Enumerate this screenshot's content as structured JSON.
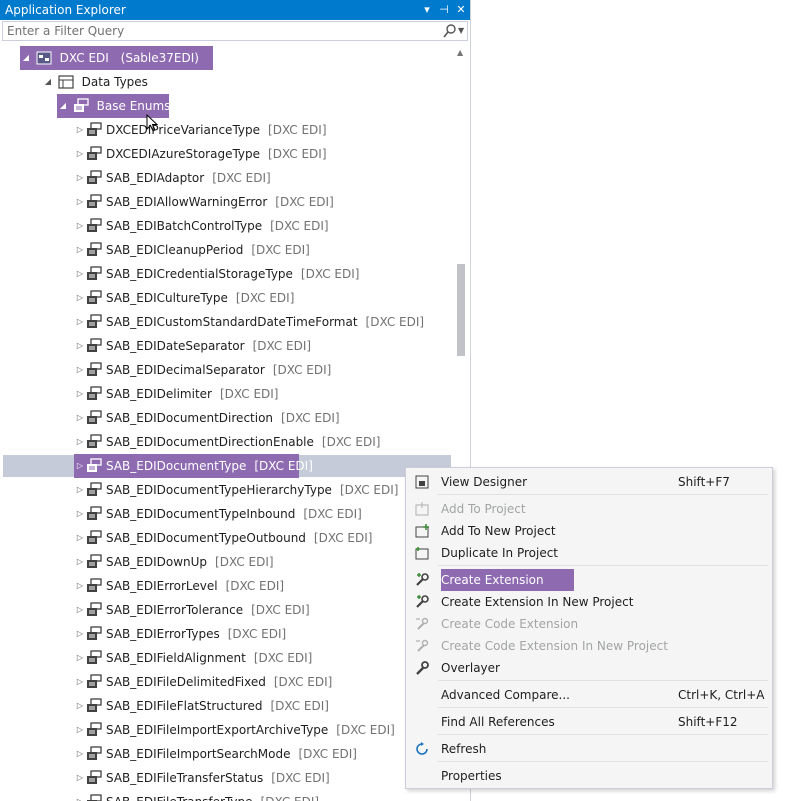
{
  "window": {
    "title": "Application Explorer",
    "buttons": [
      {
        "name": "dropdown",
        "glyph": "▾"
      },
      {
        "name": "pin",
        "glyph": "⊣"
      },
      {
        "name": "close",
        "glyph": "✕"
      }
    ]
  },
  "filter": {
    "placeholder": "Enter a Filter Query",
    "value": ""
  },
  "tree": {
    "root": {
      "label": "DXC EDI",
      "tag": "(Sable37EDI)",
      "expanded": true
    },
    "data_types": {
      "label": "Data Types",
      "expanded": true
    },
    "base_enums": {
      "label": "Base Enums",
      "expanded": true
    },
    "items": [
      {
        "label": "DXCEDIPriceVarianceType",
        "tag": "[DXC EDI]"
      },
      {
        "label": "DXCEDIAzureStorageType",
        "tag": "[DXC EDI]"
      },
      {
        "label": "SAB_EDIAdaptor",
        "tag": "[DXC EDI]"
      },
      {
        "label": "SAB_EDIAllowWarningError",
        "tag": "[DXC EDI]"
      },
      {
        "label": "SAB_EDIBatchControlType",
        "tag": "[DXC EDI]"
      },
      {
        "label": "SAB_EDICleanupPeriod",
        "tag": "[DXC EDI]"
      },
      {
        "label": "SAB_EDICredentialStorageType",
        "tag": "[DXC EDI]"
      },
      {
        "label": "SAB_EDICultureType",
        "tag": "[DXC EDI]"
      },
      {
        "label": "SAB_EDICustomStandardDateTimeFormat",
        "tag": "[DXC EDI]"
      },
      {
        "label": "SAB_EDIDateSeparator",
        "tag": "[DXC EDI]"
      },
      {
        "label": "SAB_EDIDecimalSeparator",
        "tag": "[DXC EDI]"
      },
      {
        "label": "SAB_EDIDelimiter",
        "tag": "[DXC EDI]"
      },
      {
        "label": "SAB_EDIDocumentDirection",
        "tag": "[DXC EDI]"
      },
      {
        "label": "SAB_EDIDocumentDirectionEnable",
        "tag": "[DXC EDI]"
      },
      {
        "label": "SAB_EDIDocumentType",
        "tag": "[DXC EDI]",
        "selected": true
      },
      {
        "label": "SAB_EDIDocumentTypeHierarchyType",
        "tag": "[DXC EDI]"
      },
      {
        "label": "SAB_EDIDocumentTypeInbound",
        "tag": "[DXC EDI]"
      },
      {
        "label": "SAB_EDIDocumentTypeOutbound",
        "tag": "[DXC EDI]"
      },
      {
        "label": "SAB_EDIDownUp",
        "tag": "[DXC EDI]"
      },
      {
        "label": "SAB_EDIErrorLevel",
        "tag": "[DXC EDI]"
      },
      {
        "label": "SAB_EDIErrorTolerance",
        "tag": "[DXC EDI]"
      },
      {
        "label": "SAB_EDIErrorTypes",
        "tag": "[DXC EDI]"
      },
      {
        "label": "SAB_EDIFieldAlignment",
        "tag": "[DXC EDI]"
      },
      {
        "label": "SAB_EDIFileDelimitedFixed",
        "tag": "[DXC EDI]"
      },
      {
        "label": "SAB_EDIFileFlatStructured",
        "tag": "[DXC EDI]"
      },
      {
        "label": "SAB_EDIFileImportExportArchiveType",
        "tag": "[DXC EDI]"
      },
      {
        "label": "SAB_EDIFileImportSearchMode",
        "tag": "[DXC EDI]"
      },
      {
        "label": "SAB_EDIFileTransferStatus",
        "tag": "[DXC EDI]"
      },
      {
        "label": "SAB_EDIFileTransferType",
        "tag": "[DXC EDI]"
      }
    ]
  },
  "context_menu": {
    "items": [
      {
        "label": "View Designer",
        "shortcut": "Shift+F7",
        "enabled": true,
        "icon": "view-designer-icon"
      },
      {
        "label": "Add To Project",
        "shortcut": "",
        "enabled": false,
        "icon": "add-to-project-icon"
      },
      {
        "label": "Add To New Project",
        "shortcut": "",
        "enabled": true,
        "icon": "add-to-new-project-icon"
      },
      {
        "label": "Duplicate In Project",
        "shortcut": "",
        "enabled": true,
        "icon": "duplicate-icon"
      },
      {
        "label": "Create Extension",
        "shortcut": "",
        "enabled": true,
        "active": true,
        "icon": "create-extension-icon"
      },
      {
        "label": "Create Extension In New Project",
        "shortcut": "",
        "enabled": true,
        "icon": "create-extension-icon"
      },
      {
        "label": "Create Code Extension",
        "shortcut": "",
        "enabled": false,
        "icon": "code-extension-icon"
      },
      {
        "label": "Create Code Extension In New Project",
        "shortcut": "",
        "enabled": false,
        "icon": "code-extension-icon"
      },
      {
        "label": "Overlayer",
        "shortcut": "",
        "enabled": true,
        "icon": "wrench-icon"
      },
      {
        "label": "Advanced Compare...",
        "shortcut": "Ctrl+K, Ctrl+A",
        "enabled": true,
        "icon": ""
      },
      {
        "label": "Find All References",
        "shortcut": "Shift+F12",
        "enabled": true,
        "icon": ""
      },
      {
        "label": "Refresh",
        "shortcut": "",
        "enabled": true,
        "icon": "refresh-icon"
      },
      {
        "label": "Properties",
        "shortcut": "",
        "enabled": true,
        "icon": ""
      }
    ]
  },
  "colors": {
    "title_bar": "#007acc",
    "highlight": "#8e6ab0",
    "selected_row": "#c5cbd9"
  }
}
